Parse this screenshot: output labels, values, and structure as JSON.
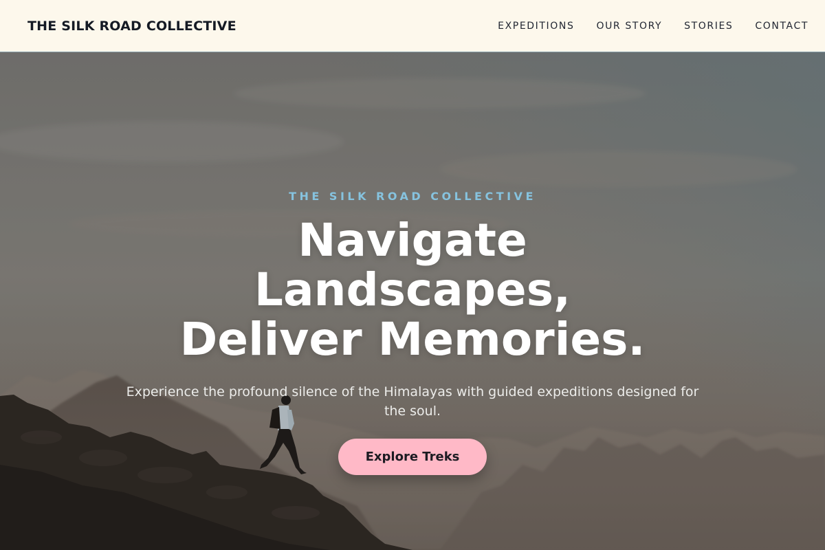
{
  "header": {
    "brand": "THE SILK ROAD COLLECTIVE",
    "nav": [
      {
        "label": "EXPEDITIONS"
      },
      {
        "label": "OUR STORY"
      },
      {
        "label": "STORIES"
      },
      {
        "label": "CONTACT"
      }
    ]
  },
  "hero": {
    "eyebrow": "THE SILK ROAD COLLECTIVE",
    "headline_lines": [
      "Navigate",
      "Landscapes,",
      "Deliver Memories."
    ],
    "subtext": "Experience the profound silence of the Himalayas with guided expeditions designed for the soul.",
    "cta_label": "Explore Treks"
  },
  "colors": {
    "header_bg": "#fdf8ec",
    "eyebrow": "#86c3df",
    "cta_bg": "#ffb9c7",
    "headline": "#ffffff"
  }
}
